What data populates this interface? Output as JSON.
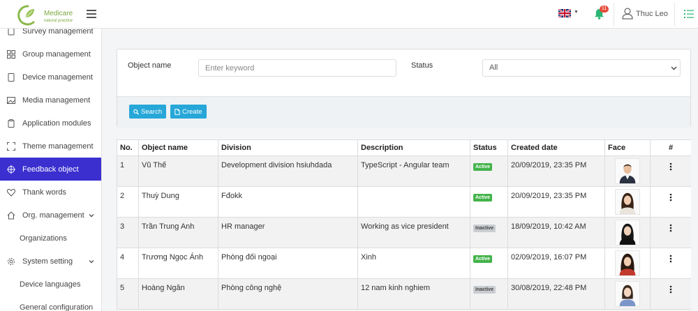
{
  "header": {
    "logo_name": "Medicare",
    "logo_tagline": "natural practice",
    "notification_count": "11",
    "user_name": "Thuc Leo"
  },
  "sidebar": {
    "items": [
      {
        "label": "Survey management",
        "icon": "clipboard-icon"
      },
      {
        "label": "Group management",
        "icon": "grid-icon"
      },
      {
        "label": "Device management",
        "icon": "tablet-icon"
      },
      {
        "label": "Media management",
        "icon": "image-icon"
      },
      {
        "label": "Application modules",
        "icon": "clipboard-icon"
      },
      {
        "label": "Theme management",
        "icon": "frame-icon"
      },
      {
        "label": "Feedback object",
        "icon": "crosshair-icon",
        "active": true
      },
      {
        "label": "Thank words",
        "icon": "heart-icon"
      },
      {
        "label": "Org. management",
        "icon": "home-icon",
        "expandable": true
      },
      {
        "label": "Organizations",
        "sub": true
      },
      {
        "label": "System setting",
        "icon": "gear-icon",
        "expandable": true
      },
      {
        "label": "Device languages",
        "sub": true
      },
      {
        "label": "General configuration",
        "sub": true
      }
    ]
  },
  "filter": {
    "object_name_label": "Object name",
    "object_name_placeholder": "Enter keyword",
    "status_label": "Status",
    "status_value": "All",
    "search_label": "Search",
    "create_label": "Create"
  },
  "table": {
    "headers": [
      "No.",
      "Object name",
      "Division",
      "Description",
      "Status",
      "Created date",
      "Face",
      "#"
    ],
    "rows": [
      {
        "no": "1",
        "name": "Vũ Thế",
        "division": "Development division hsiuhdada",
        "description": "TypeScript - Angular team",
        "status": "Active",
        "created": "20/09/2019, 23:35 PM"
      },
      {
        "no": "2",
        "name": "Thuỳ Dung",
        "division": "Fđokk",
        "description": "",
        "status": "Active",
        "created": "20/09/2019, 23:35 PM"
      },
      {
        "no": "3",
        "name": "Trần Trung Anh",
        "division": "HR manager",
        "description": "Working as vice president",
        "status": "Inactive",
        "created": "18/09/2019, 10:42 AM"
      },
      {
        "no": "4",
        "name": "Trương Ngọc Ánh",
        "division": "Phòng đối ngoại",
        "description": "Xinh",
        "status": "Active",
        "created": "02/09/2019, 16:07 PM"
      },
      {
        "no": "5",
        "name": "Hoàng Ngân",
        "division": "Phòng công nghệ",
        "description": "12 nam kinh nghiem",
        "status": "Inactive",
        "created": "30/08/2019, 22:48 PM"
      }
    ]
  },
  "colors": {
    "active_nav": "#3b2fd0",
    "button": "#26a7d8",
    "badge_active": "#43b34a",
    "badge_inactive": "#c9ccd0",
    "logo_green": "#7aa83c"
  }
}
